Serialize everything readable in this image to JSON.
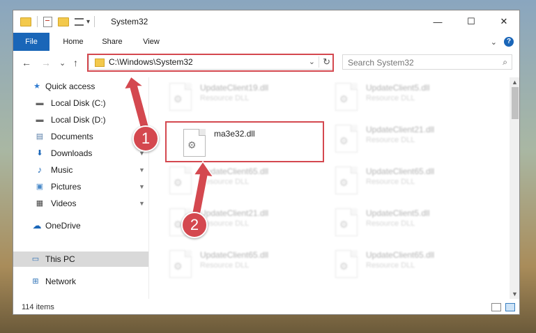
{
  "window": {
    "title": "System32",
    "minimize": "—",
    "maximize": "☐",
    "close": "✕",
    "dropdown_symbol": "▾"
  },
  "ribbon": {
    "tabs": [
      "File",
      "Home",
      "Share",
      "View"
    ],
    "expand_symbol": "⌄",
    "help_symbol": "?"
  },
  "navigation": {
    "back": "←",
    "forward": "→",
    "recent": "⌄",
    "up": "↑",
    "address": "C:\\Windows\\System32",
    "address_dropdown": "⌄",
    "refresh": "↻",
    "search_placeholder": "Search System32",
    "search_icon": "⌕"
  },
  "sidebar": {
    "items": [
      {
        "label": "Quick access",
        "icon": "star-icon",
        "glyph": "★",
        "pinned": false
      },
      {
        "label": "Local Disk (C:)",
        "icon": "drive-icon",
        "glyph": "▬",
        "pinned": false
      },
      {
        "label": "Local Disk (D:)",
        "icon": "drive-icon",
        "glyph": "▬",
        "pinned": false
      },
      {
        "label": "Documents",
        "icon": "documents-icon",
        "glyph": "▤",
        "pinned": true
      },
      {
        "label": "Downloads",
        "icon": "download-icon",
        "glyph": "⬇",
        "pinned": true
      },
      {
        "label": "Music",
        "icon": "music-icon",
        "glyph": "♪",
        "pinned": true
      },
      {
        "label": "Pictures",
        "icon": "pictures-icon",
        "glyph": "▣",
        "pinned": true
      },
      {
        "label": "Videos",
        "icon": "video-icon",
        "glyph": "▦",
        "pinned": true
      },
      {
        "label": "OneDrive",
        "icon": "cloud-icon",
        "glyph": "☁",
        "pinned": false
      },
      {
        "label": "This PC",
        "icon": "computer-icon",
        "glyph": "▭",
        "pinned": false,
        "selected": true
      },
      {
        "label": "Network",
        "icon": "network-icon",
        "glyph": "⊞",
        "pinned": false
      }
    ],
    "pin_glyph": "📌"
  },
  "files": {
    "highlighted": {
      "name": "ma3e32.dll",
      "type": ""
    },
    "background": [
      {
        "name": "UpdateClient19.dll",
        "type": "Resource DLL"
      },
      {
        "name": "UpdateClient5.dll",
        "type": "Resource DLL"
      },
      {
        "name": "UpdateClient21.dll",
        "type": "Resource DLL"
      },
      {
        "name": "UpdateClient65.dll",
        "type": "Resource DLL"
      },
      {
        "name": "UpdateClient65.dll",
        "type": "Resource DLL"
      },
      {
        "name": "UpdateClient21.dll",
        "type": "Resource DLL"
      },
      {
        "name": "UpdateClient5.dll",
        "type": "Resource DLL"
      },
      {
        "name": "UpdateClient65.dll",
        "type": "Resource DLL"
      },
      {
        "name": "UpdateClient65.dll",
        "type": "Resource DLL"
      }
    ],
    "gear_glyph": "⚙"
  },
  "status": {
    "item_count": "114 items"
  },
  "annotations": {
    "step1": "1",
    "step2": "2",
    "color": "#d4484f"
  }
}
